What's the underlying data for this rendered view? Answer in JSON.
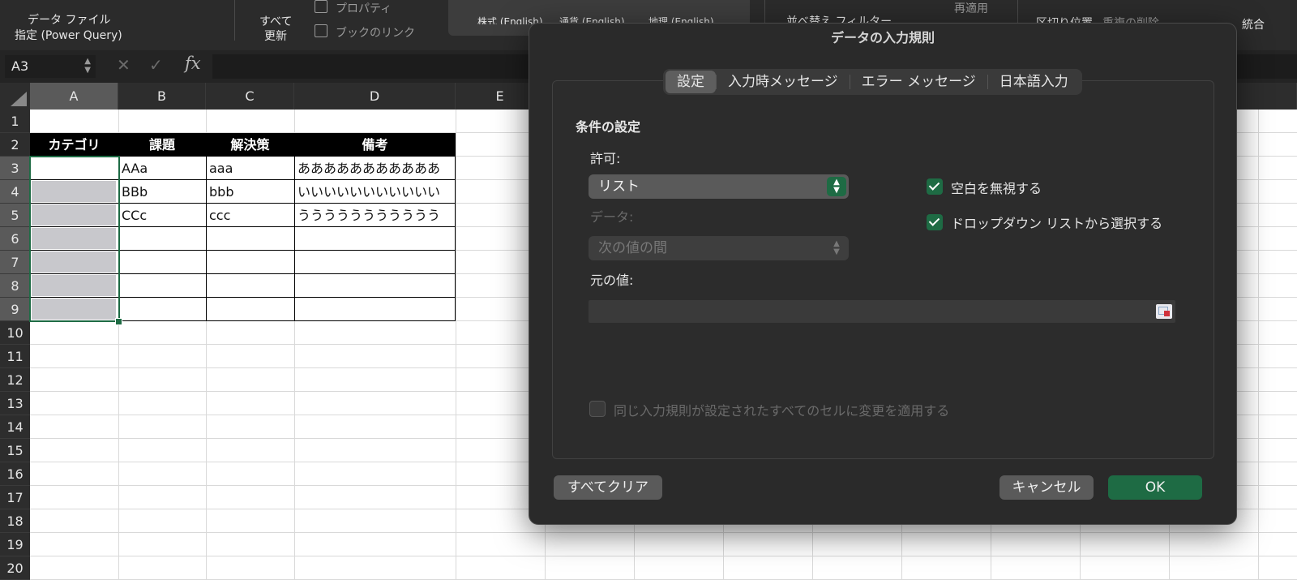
{
  "ribbon": {
    "data_file_line1": "データ ファイル",
    "data_file_line2": "指定 (Power Query)",
    "refresh_all_line1": "すべて",
    "refresh_all_line2": "更新",
    "properties": "プロパティ",
    "book_links": "ブックのリンク",
    "stocks": "株式 (English)",
    "currency": "通貨 (English)",
    "geography": "地理 (English)",
    "sort_filter": "並べ替え  フィルター",
    "reapply": "再適用",
    "text_to_columns": "区切り位置",
    "remove_duplicates": "重複の削除",
    "consolidate": "統合"
  },
  "formula_bar": {
    "name_box": "A3",
    "fx": "fx"
  },
  "sheet": {
    "columns": [
      "A",
      "B",
      "C",
      "D",
      "E"
    ],
    "rows": [
      "1",
      "2",
      "3",
      "4",
      "5",
      "6",
      "7",
      "8",
      "9",
      "10",
      "11",
      "12",
      "13",
      "14",
      "15",
      "16",
      "17",
      "18",
      "19",
      "20"
    ],
    "headers": [
      "カテゴリ",
      "課題",
      "解決策",
      "備考"
    ],
    "data": [
      [
        "",
        "AAa",
        "aaa",
        "あああああああああああ"
      ],
      [
        "",
        "BBb",
        "bbb",
        "いいいいいいいいいいい"
      ],
      [
        "",
        "CCc",
        "ccc",
        "ううううううううううう"
      ]
    ]
  },
  "dialog": {
    "title": "データの入力規則",
    "tabs": [
      "設定",
      "入力時メッセージ",
      "エラー メッセージ",
      "日本語入力"
    ],
    "active_tab": 0,
    "section_title": "条件の設定",
    "allow_label": "許可:",
    "allow_value": "リスト",
    "data_label": "データ:",
    "data_value": "次の値の間",
    "source_label": "元の値:",
    "source_value": "",
    "ignore_blank": "空白を無視する",
    "in_cell_dropdown": "ドロップダウン リストから選択する",
    "apply_to_all": "同じ入力規則が設定されたすべてのセルに変更を適用する",
    "clear_all": "すべてクリア",
    "cancel": "キャンセル",
    "ok": "OK"
  },
  "colors": {
    "accent_green": "#1e6b44",
    "dialog_bg": "#2a2a2a",
    "ribbon_bg": "#2b2b2b"
  }
}
